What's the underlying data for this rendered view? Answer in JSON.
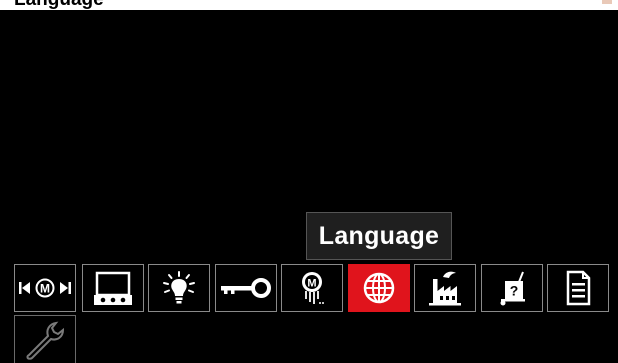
{
  "header": {
    "title_fragment": "Language"
  },
  "tooltip": {
    "label": "Language"
  },
  "menu": {
    "selected_index": 5,
    "items": [
      {
        "icon": "memory-recall-icon",
        "name": "memory-recall"
      },
      {
        "icon": "display-icon",
        "name": "display"
      },
      {
        "icon": "brightness-bulb-icon",
        "name": "brightness"
      },
      {
        "icon": "key-lock-icon",
        "name": "security"
      },
      {
        "icon": "wire-spool-icon",
        "name": "wire-feed"
      },
      {
        "icon": "globe-icon",
        "name": "language"
      },
      {
        "icon": "factory-icon",
        "name": "factory-reset"
      },
      {
        "icon": "cart-help-icon",
        "name": "help"
      },
      {
        "icon": "document-icon",
        "name": "information"
      },
      {
        "icon": "wrench-icon",
        "name": "service"
      }
    ]
  },
  "colors": {
    "background": "#000000",
    "selected": "#e0141c",
    "tile_border": "#8a8a8a",
    "icon": "#ffffff",
    "wrench_icon": "#7a7a7a"
  }
}
